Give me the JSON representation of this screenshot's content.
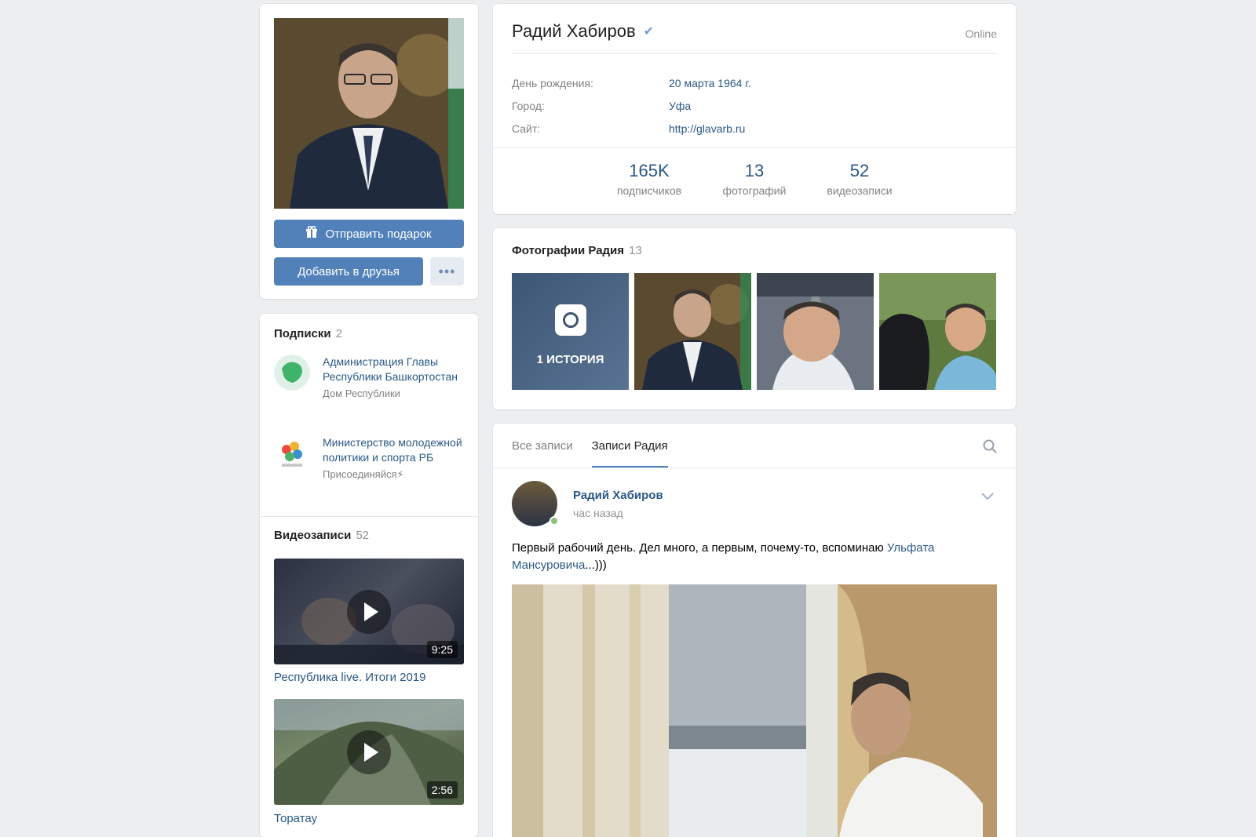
{
  "profile": {
    "name": "Радий Хабиров",
    "status": "Online",
    "info": [
      {
        "label": "День рождения:",
        "value": "20 марта 1964 г."
      },
      {
        "label": "Город:",
        "value": "Уфа"
      },
      {
        "label": "Сайт:",
        "value": "http://glavarb.ru"
      }
    ],
    "counters": [
      {
        "value": "165K",
        "label": "подписчиков"
      },
      {
        "value": "13",
        "label": "фотографий"
      },
      {
        "value": "52",
        "label": "видеозаписи"
      }
    ]
  },
  "actions": {
    "gift_label": "Отправить подарок",
    "add_friend_label": "Добавить в друзья",
    "more_label": "•••"
  },
  "subscriptions": {
    "title": "Подписки",
    "count": "2",
    "items": [
      {
        "name": "Администрация Главы Республики Башкортостан",
        "desc": "Дом Республики"
      },
      {
        "name": "Министерство молодежной политики и спорта РБ",
        "desc": "Присоединяйся⚡"
      }
    ]
  },
  "videos": {
    "title": "Видеозаписи",
    "count": "52",
    "items": [
      {
        "title": "Республика live. Итоги 2019",
        "duration": "9:25"
      },
      {
        "title": "Торатау",
        "duration": "2:56"
      }
    ]
  },
  "photos": {
    "title": "Фотографии Радия",
    "count": "13",
    "story_label": "1 ИСТОРИЯ"
  },
  "wall": {
    "tabs": [
      "Все записи",
      "Записи Радия"
    ],
    "post": {
      "author": "Радий Хабиров",
      "time": "час назад",
      "text": "Первый рабочий день. Дел много, а первым, почему-то, вспоминаю ",
      "link_text": "Ульфата Мансуровича",
      "text_end": "...)))"
    }
  },
  "colors": {
    "accent": "#5181b8",
    "link": "#2a5885",
    "background": "#edeef0"
  }
}
